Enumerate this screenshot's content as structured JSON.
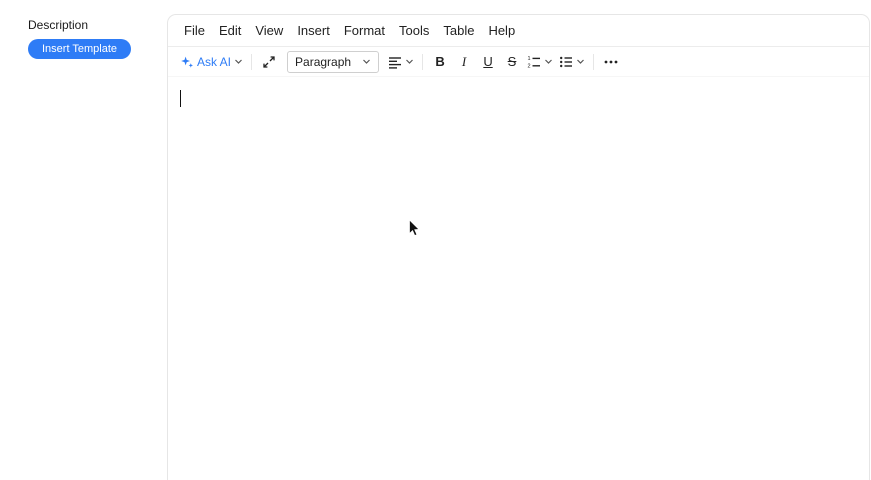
{
  "sidebar": {
    "description_label": "Description",
    "insert_template_button": "Insert Template"
  },
  "editor": {
    "menu": [
      "File",
      "Edit",
      "View",
      "Insert",
      "Format",
      "Tools",
      "Table",
      "Help"
    ],
    "toolbar": {
      "ask_ai_label": "Ask AI",
      "paragraph_format": "Paragraph",
      "bold": "B",
      "italic": "I",
      "underline": "U",
      "strikethrough": "S"
    },
    "content_text": ""
  },
  "icons": {
    "ask_ai": "sparkle-icon",
    "fullscreen": "fullscreen-icon",
    "alignment": "align-left-icon",
    "ordered_list": "ordered-list-icon",
    "bullet_list": "bullet-list-icon",
    "more": "ellipsis-icon",
    "dropdowns": "chevron-down-icon",
    "pointer": "mouse-cursor"
  },
  "colors": {
    "accent": "#2e7cf6",
    "editor_border": "#e6e6e6",
    "toolbar_text": "#222222"
  }
}
